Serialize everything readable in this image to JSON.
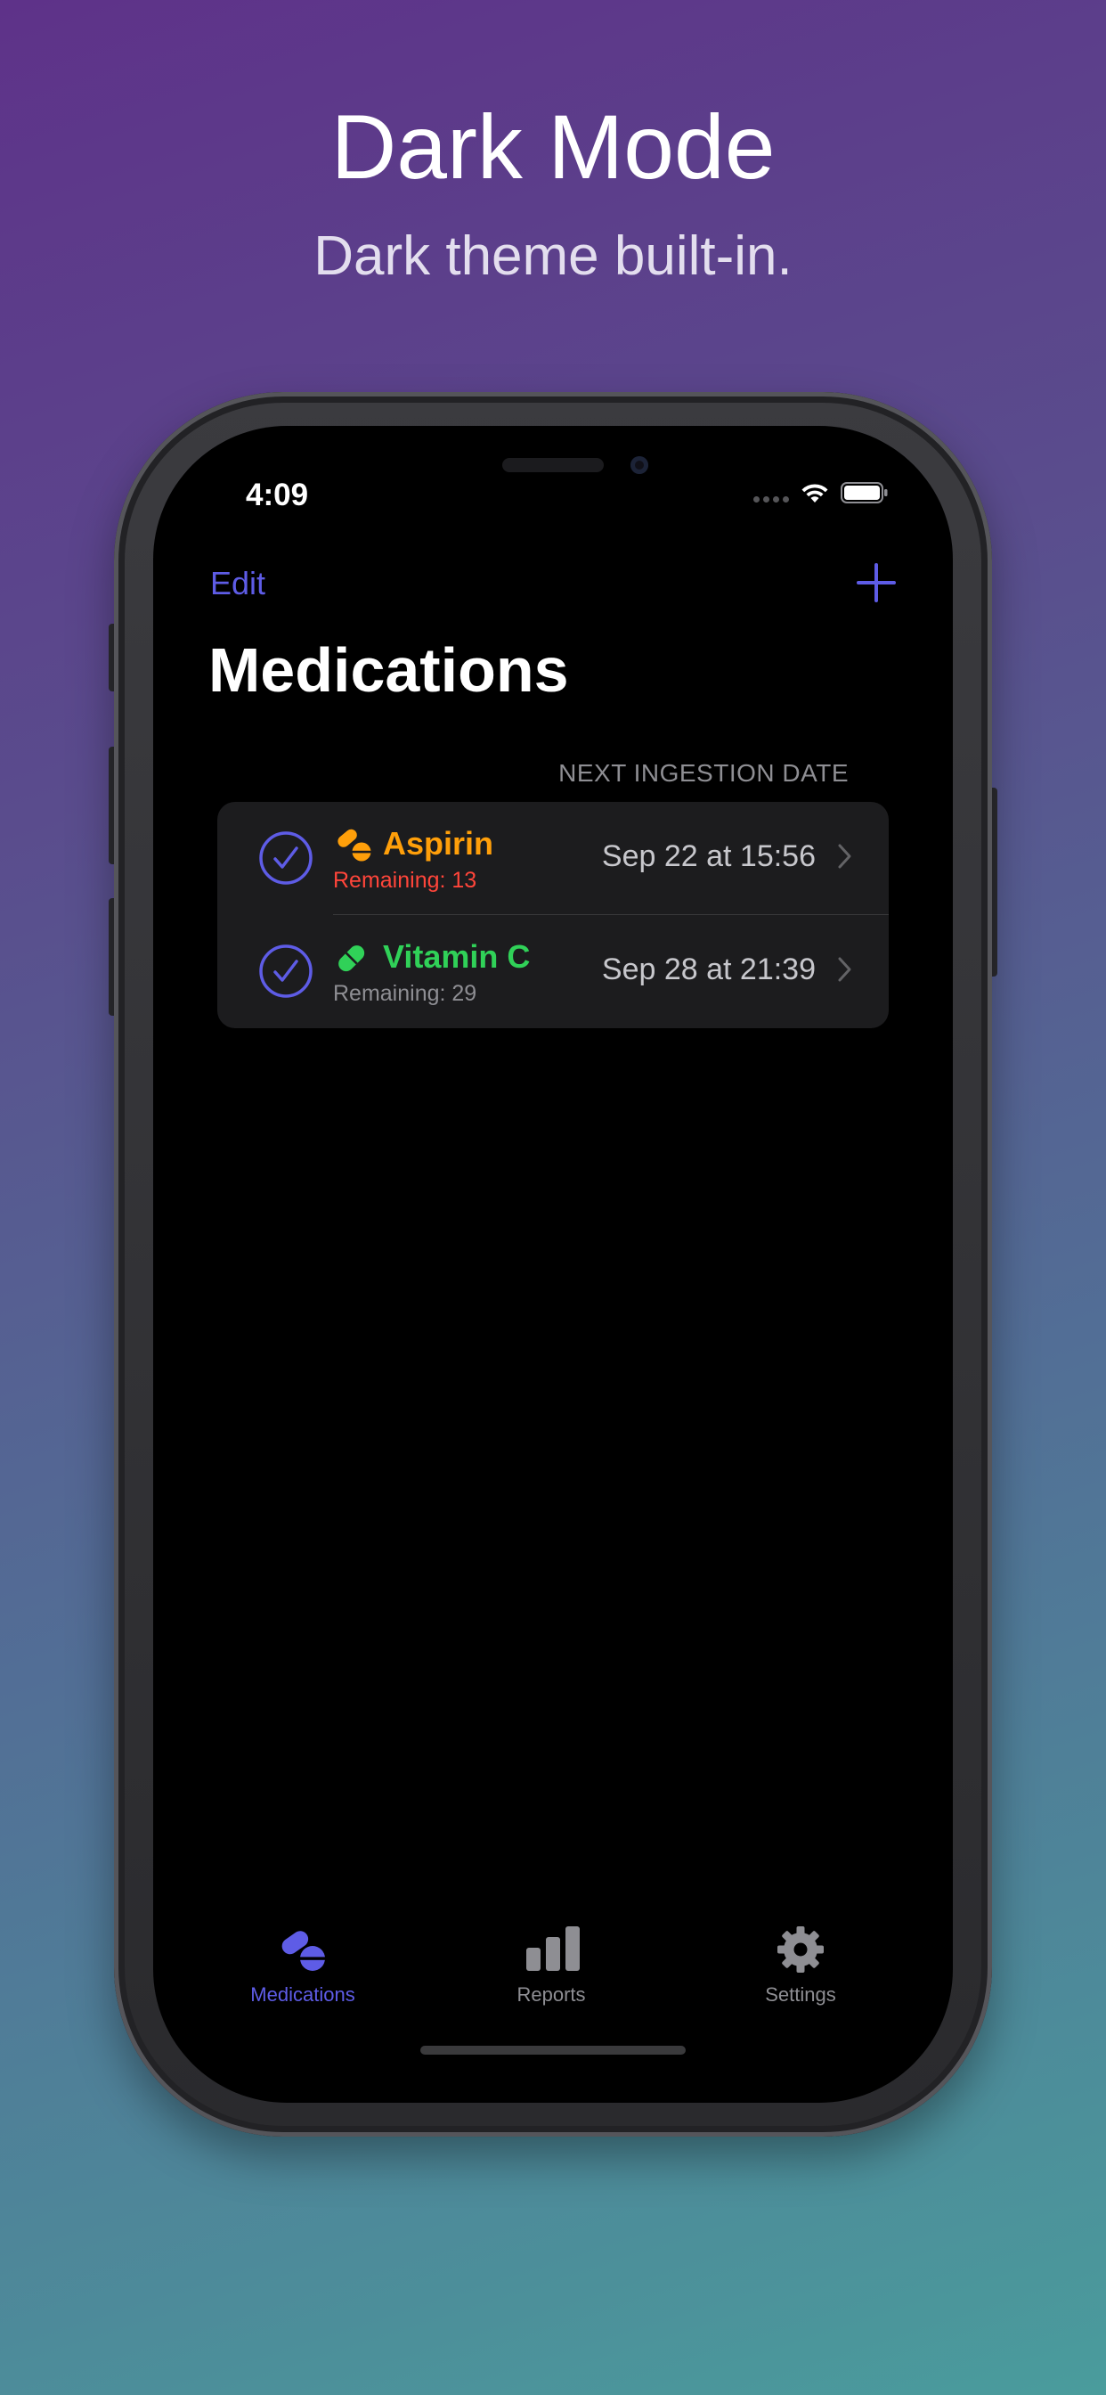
{
  "promo": {
    "title": "Dark Mode",
    "subtitle": "Dark theme built-in."
  },
  "status_bar": {
    "time": "4:09",
    "icons": [
      "cellular-dots-icon",
      "wifi-icon",
      "battery-icon"
    ]
  },
  "nav": {
    "edit_label": "Edit",
    "add_icon": "plus-icon",
    "title": "Medications"
  },
  "list": {
    "section_header": "NEXT INGESTION DATE",
    "items": [
      {
        "name": "Aspirin",
        "remaining": "Remaining: 13",
        "next_date": "Sep 22 at 15:56",
        "name_color": "#ff9f0a",
        "remaining_color": "#ff453a",
        "icon": "pills-icon",
        "checked": true
      },
      {
        "name": "Vitamin C",
        "remaining": "Remaining: 29",
        "next_date": "Sep 28 at 21:39",
        "name_color": "#30d158",
        "remaining_color": "#8e8e93",
        "icon": "capsule-icon",
        "checked": true
      }
    ]
  },
  "tab_bar": {
    "tabs": [
      {
        "label": "Medications",
        "icon": "pills-icon",
        "selected": true
      },
      {
        "label": "Reports",
        "icon": "bar-chart-icon",
        "selected": false
      },
      {
        "label": "Settings",
        "icon": "gear-icon",
        "selected": false
      }
    ]
  },
  "colors": {
    "accent": "#5e5ce6",
    "background": "#000000",
    "card": "#1c1c1e",
    "secondary_text": "#8e8e93",
    "inactive_tab": "#8e8e93"
  }
}
